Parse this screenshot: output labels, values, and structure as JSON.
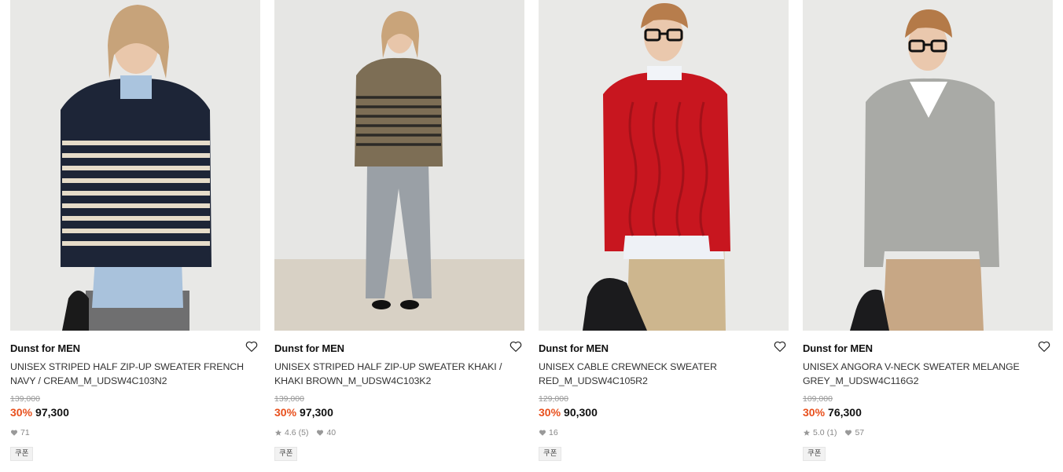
{
  "colors": {
    "discount": "#e8501d",
    "muted": "#888888",
    "text": "#111111"
  },
  "products": [
    {
      "brand": "Dunst for MEN",
      "name": "UNISEX STRIPED HALF ZIP-UP SWEATER FRENCH NAVY / CREAM_M_UDSW4C103N2",
      "original_price": "139,000",
      "discount": "30%",
      "price": "97,300",
      "rating": "",
      "reviews": "",
      "likes": "71",
      "badge": "쿠폰",
      "image_icon": "model-photo-striped-navy-sweater"
    },
    {
      "brand": "Dunst for MEN",
      "name": "UNISEX STRIPED HALF ZIP-UP SWEATER KHAKI / KHAKI BROWN_M_UDSW4C103K2",
      "original_price": "139,000",
      "discount": "30%",
      "price": "97,300",
      "rating": "4.6",
      "reviews": "(5)",
      "likes": "40",
      "badge": "쿠폰",
      "image_icon": "model-photo-striped-khaki-sweater"
    },
    {
      "brand": "Dunst for MEN",
      "name": "UNISEX CABLE CREWNECK SWEATER RED_M_UDSW4C105R2",
      "original_price": "129,000",
      "discount": "30%",
      "price": "90,300",
      "rating": "",
      "reviews": "",
      "likes": "16",
      "badge": "쿠폰",
      "image_icon": "model-photo-red-cable-sweater"
    },
    {
      "brand": "Dunst for MEN",
      "name": "UNISEX ANGORA V-NECK SWEATER MELANGE GREY_M_UDSW4C116G2",
      "original_price": "109,000",
      "discount": "30%",
      "price": "76,300",
      "rating": "5.0",
      "reviews": "(1)",
      "likes": "57",
      "badge": "쿠폰",
      "image_icon": "model-photo-grey-vneck-sweater"
    }
  ]
}
